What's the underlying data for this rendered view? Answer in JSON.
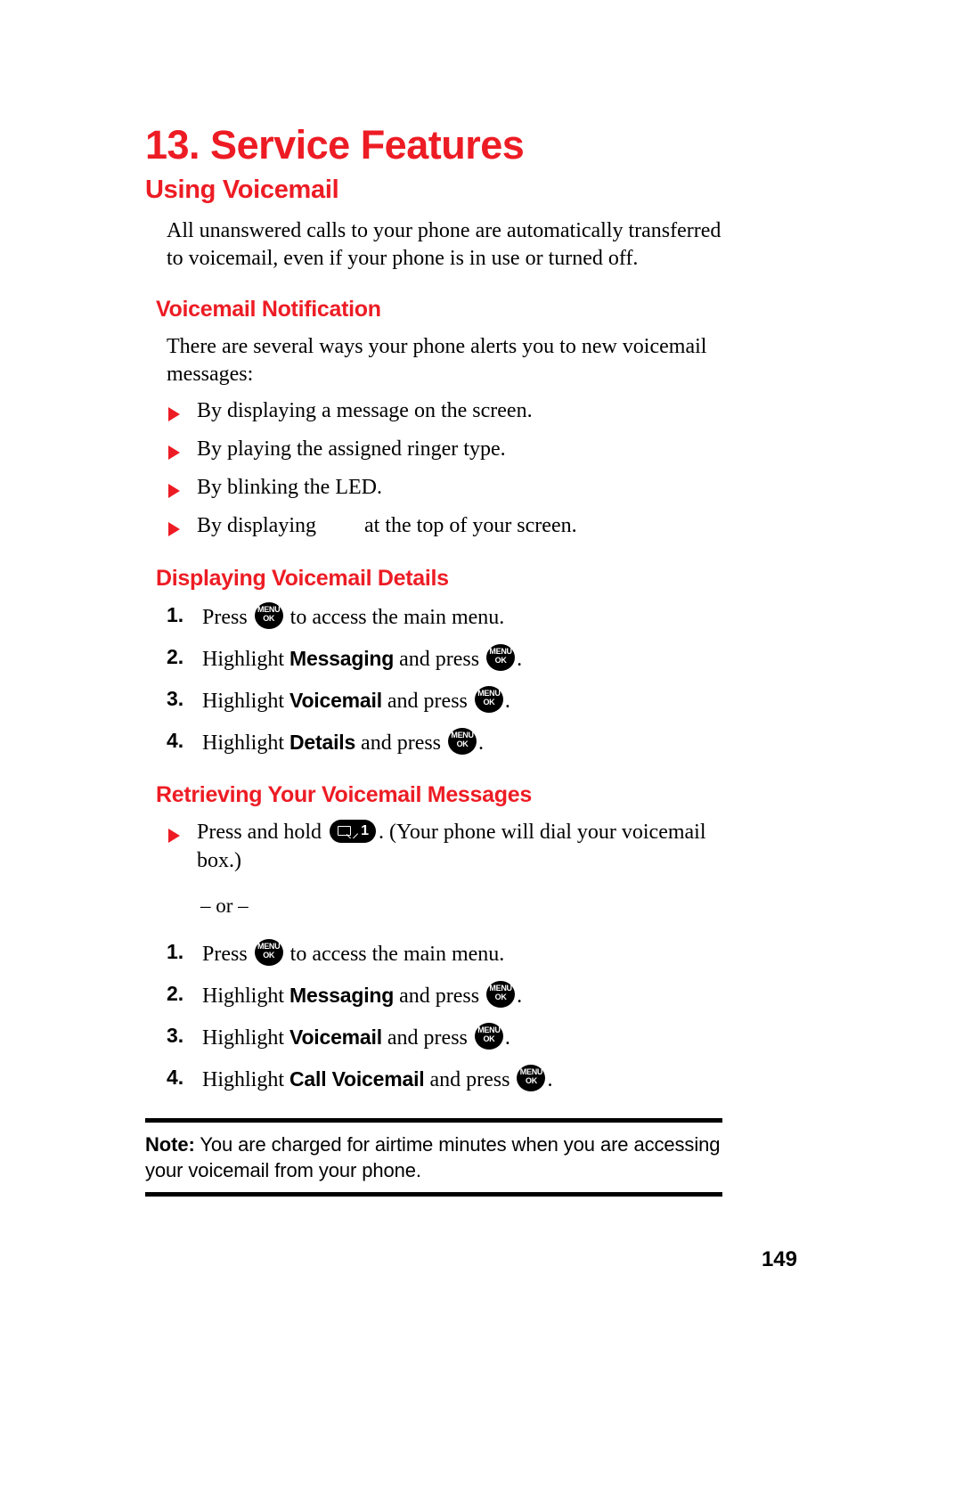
{
  "chapter": {
    "title": "13. Service Features"
  },
  "section": {
    "title": "Using Voicemail",
    "intro": "All unanswered calls to your phone are automatically transferred to voicemail, even if your phone is in use or turned off."
  },
  "voicemail_notification": {
    "title": "Voicemail Notification",
    "intro": "There are several ways your phone alerts you to new voicemail messages:",
    "bullets": [
      {
        "text": "By displaying a message on the screen."
      },
      {
        "text": "By playing the assigned ringer type."
      },
      {
        "text": "By blinking the LED."
      },
      {
        "prefix": "By displaying",
        "icon": "voicemail-indicator-icon",
        "suffix": "at the top of your screen."
      }
    ]
  },
  "displaying_voicemail_details": {
    "title": "Displaying Voicemail Details",
    "steps": [
      {
        "num": "1.",
        "pre": "Press",
        "icon": "menu-ok-key-icon",
        "post": "to access the main menu."
      },
      {
        "num": "2.",
        "pre": "Highlight",
        "keyword": "Messaging",
        "mid": "and press",
        "icon": "menu-ok-key-icon",
        "post": "."
      },
      {
        "num": "3.",
        "pre": "Highlight",
        "keyword": "Voicemail",
        "mid": "and press",
        "icon": "menu-ok-key-icon",
        "post": "."
      },
      {
        "num": "4.",
        "pre": "Highlight",
        "keyword": "Details",
        "mid": "and press",
        "icon": "menu-ok-key-icon",
        "post": "."
      }
    ]
  },
  "retrieving_voicemail_messages": {
    "title": "Retrieving Your Voicemail Messages",
    "bullet": {
      "pre": "Press and hold",
      "icon": "voicemail-speeddial-key-icon",
      "icon_number": "1",
      "post": ". (Your phone will dial your voicemail box.)"
    },
    "or_separator": "– or –",
    "steps": [
      {
        "num": "1.",
        "pre": "Press",
        "icon": "menu-ok-key-icon",
        "post": "to access the main menu."
      },
      {
        "num": "2.",
        "pre": "Highlight",
        "keyword": "Messaging",
        "mid": "and press",
        "icon": "menu-ok-key-icon",
        "post": "."
      },
      {
        "num": "3.",
        "pre": "Highlight",
        "keyword": "Voicemail",
        "mid": "and press",
        "icon": "menu-ok-key-icon",
        "post": "."
      },
      {
        "num": "4.",
        "pre": "Highlight",
        "keyword": "Call Voicemail",
        "mid": "and press",
        "icon": "menu-ok-key-icon",
        "post": "."
      }
    ]
  },
  "note": {
    "label": "Note:",
    "text": " You are charged for airtime minutes when you are accessing your voicemail from your phone."
  },
  "footer": {
    "page_number": "149"
  },
  "key_icon": {
    "menu_label": "MENU",
    "ok_label": "OK"
  },
  "colors": {
    "heading_red": "#ed1c24",
    "body_black": "#000000",
    "page_background": "#ffffff"
  }
}
